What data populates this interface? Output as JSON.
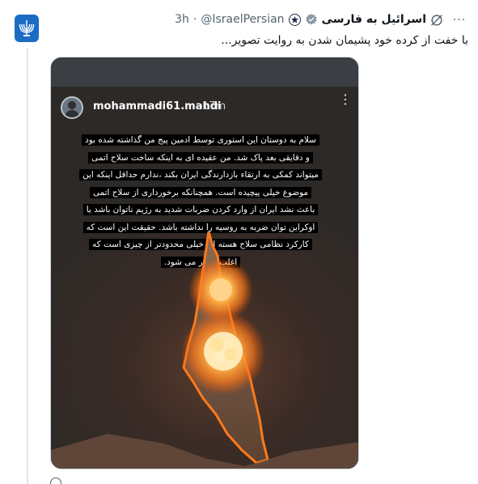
{
  "tweet": {
    "display_name": "اسرائیل به فارسی",
    "handle": "@IsraelPersian",
    "separator": "·",
    "time": "3h",
    "text": "با خفت از کرده خود پشیمان شدن به روایت تصویر...",
    "more_label": "···"
  },
  "story": {
    "username": "mohammadi61.mahdi",
    "time": "17m",
    "caption_lines": [
      "سلام به دوستان این استوری توسط ادمین پیج من گذاشته شده بود",
      "و دقایقی بعد پاک شد. من عقیده ای به اینکه ساخت سلاح اتمی",
      "میتواند کمکی به ارتقاء بازدارندگی ایران بکند ،ندارم حداقل اینکه این",
      "موضوع خیلی پیچیده است. همچنانکه برخورداری از سلاح اتمی",
      "باعث نشد ایران از وارد کردن ضربات شدید به رژیم ناتوان باشد یا",
      "اوکراین توان ضربه به روسیه را نداشته باشد. حقیقت این است که",
      "کارکرد نظامی سلاح هسته ای خیلی محدودتر از چیزی است که",
      "اغلب تصور می شود."
    ]
  },
  "icons": {
    "avatar": "israel-emblem-icon",
    "verified": "verified-badge-icon",
    "affiliate": "emblem-badge-icon",
    "grok": "grok-icon",
    "more": "more-dots-icon"
  },
  "colors": {
    "verified": "#1d9bf0",
    "avatar_bg": "#1d6cc4",
    "explosion": "#ff8a1e"
  }
}
